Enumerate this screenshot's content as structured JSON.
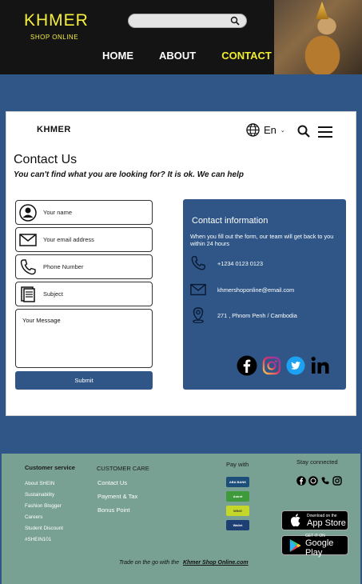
{
  "header": {
    "brand": "KHMER",
    "brand_sub": "SHOP ONLINE",
    "nav": [
      "HOME",
      "ABOUT",
      "CONTACT"
    ]
  },
  "card": {
    "logo": "KHMER",
    "language": "En",
    "title": "Contact Us",
    "subtitle": "You can't find what you are looking for? It is ok. We can help",
    "fields": {
      "name": "Your name",
      "email": "Your email address",
      "phone": "Phone Number",
      "subject": "Subject",
      "message": "Your Message"
    },
    "submit": "Submit"
  },
  "info": {
    "title": "Contact information",
    "description": "When you fill out the form, our team will get back to you within 24 hours",
    "phone": "+1234 0123 0123",
    "email": "khmershoponline@email.com",
    "address": "271 , Phnom Penh / Cambodia"
  },
  "footer": {
    "customer_service_title": "Customer service",
    "customer_service_links": [
      "About SHEIN",
      "Sustainability",
      "Fashion Blogger",
      "Careers",
      "Student Discount",
      "#SHEIN101"
    ],
    "customer_care_title": "CUSTOMER CARE",
    "customer_care_links": [
      "Contact Us",
      "Payment & Tax",
      "Bonus Point"
    ],
    "pay_with_title": "Pay with",
    "payments": [
      "ABA BANK",
      "Amret",
      "WING",
      "Wallet"
    ],
    "stay_connected": "Stay connected",
    "app_store": {
      "small": "Download on the",
      "big": "App Store"
    },
    "google_play": {
      "small": "GET IT ON",
      "big": "Google Play"
    },
    "trade_prefix": "Trade on the go with the",
    "trade_link": "Khmer Shop Online.com"
  },
  "colors": {
    "brand_yellow": "#f4ee3e",
    "primary_blue": "#2f5686",
    "footer_green": "#78a093"
  }
}
